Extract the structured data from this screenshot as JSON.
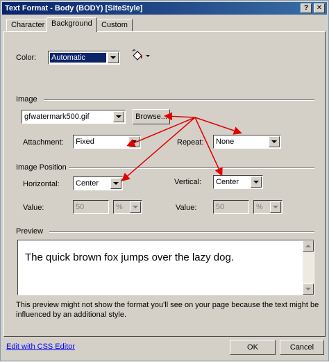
{
  "window": {
    "title": "Text Format - Body (BODY) [SiteStyle]",
    "help_btn": "?",
    "close_btn": "✕"
  },
  "tabs": [
    {
      "label": "Character"
    },
    {
      "label": "Background"
    },
    {
      "label": "Custom"
    }
  ],
  "color": {
    "label": "Color:",
    "value": "Automatic"
  },
  "image": {
    "section": "Image",
    "file": "gfwatermark500.gif",
    "browse": "Browse...",
    "attachment_label": "Attachment:",
    "attachment_value": "Fixed",
    "repeat_label": "Repeat:",
    "repeat_value": "None"
  },
  "position": {
    "section": "Image Position",
    "horizontal_label": "Horizontal:",
    "horizontal_value": "Center",
    "vertical_label": "Vertical:",
    "vertical_value": "Center",
    "value_label": "Value:",
    "h_value": "50",
    "h_unit": "%",
    "v_value": "50",
    "v_unit": "%"
  },
  "preview": {
    "section": "Preview",
    "text": "The quick brown fox jumps over the lazy dog.",
    "note_line1": "This preview might not show the format you'll see on your page because the text might be",
    "note_line2": "influenced by an additional style."
  },
  "footer": {
    "css_link": "Edit with CSS Editor",
    "ok": "OK",
    "cancel": "Cancel"
  },
  "colors": {
    "titlebar": "#0a246a",
    "dialog": "#d4d0c8",
    "selection": "#0a246a",
    "annotation_arrow": "#e00000"
  }
}
